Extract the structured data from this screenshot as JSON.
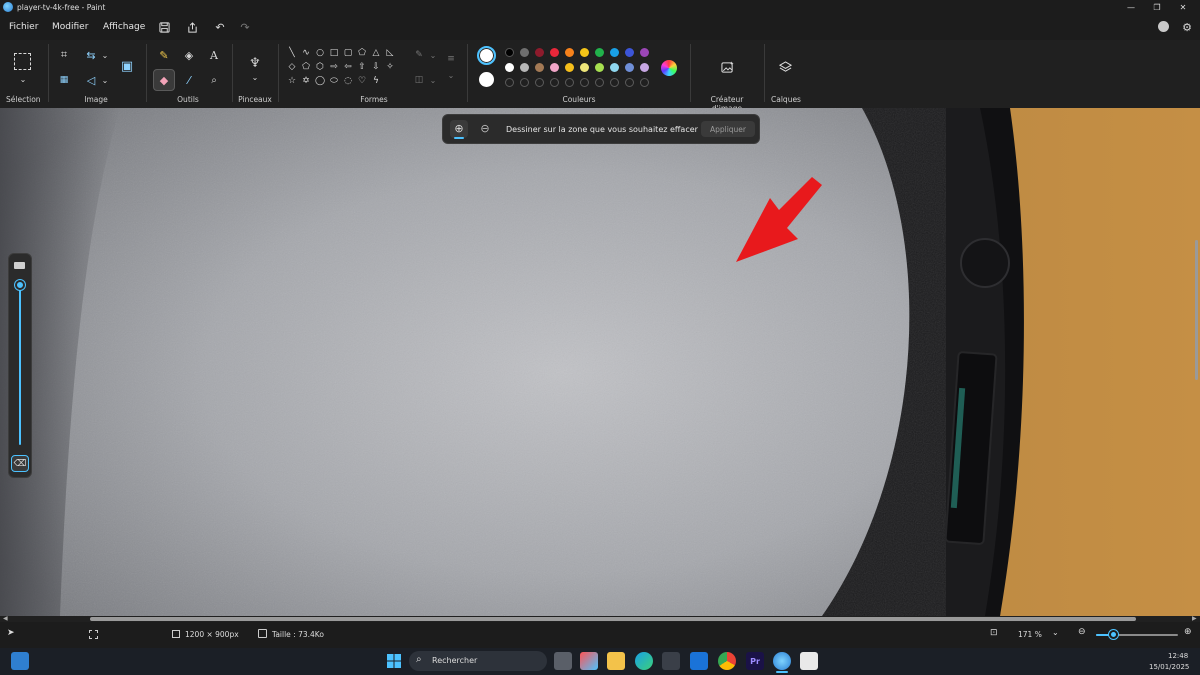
{
  "window": {
    "title": "player-tv-4k-free - Paint"
  },
  "menu": {
    "file": "Fichier",
    "edit": "Modifier",
    "view": "Affichage"
  },
  "ribbon": {
    "groups": {
      "selection": "Sélection",
      "image": "Image",
      "tools": "Outils",
      "brushes": "Pinceaux",
      "shapes": "Formes",
      "colors": "Couleurs",
      "image_creator": "Créateur d'image",
      "layers": "Calques"
    },
    "palette_row1": [
      "#000000",
      "#6f6f6f",
      "#8e1b2c",
      "#e8273a",
      "#f7821b",
      "#f5c518",
      "#21b24b",
      "#19a0e6",
      "#3c55d8",
      "#9b46b6"
    ],
    "palette_row2": [
      "#ffffff",
      "#b6b6b6",
      "#a47a55",
      "#f2a6c8",
      "#f6bf1b",
      "#efe67a",
      "#a7e050",
      "#8fd7ef",
      "#6f8fd8",
      "#c7a7e3"
    ]
  },
  "erase_toolbar": {
    "instruction": "Dessiner sur la zone que vous souhaitez effacer",
    "apply_label": "Appliquer"
  },
  "status": {
    "dimensions": "1200 × 900px",
    "size": "Taille : 73.4Ko",
    "zoom": "171 %",
    "zoom_fraction": 0.22
  },
  "taskbar": {
    "search_placeholder": "Rechercher",
    "time": "12:48",
    "date": "15/01/2025"
  },
  "accent": "#4cc2ff"
}
